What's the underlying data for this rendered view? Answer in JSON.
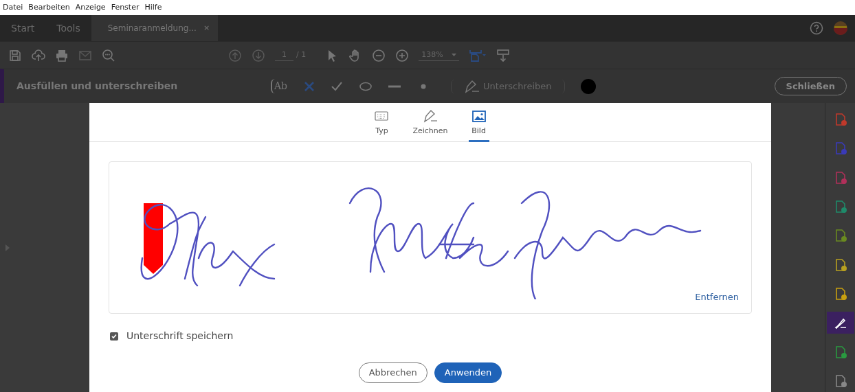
{
  "menu": [
    "Datei",
    "Bearbeiten",
    "Anzeige",
    "Fenster",
    "Hilfe"
  ],
  "tabs": [
    {
      "label": "Start",
      "selected": false
    },
    {
      "label": "Tools",
      "selected": false
    },
    {
      "label": "Seminaranmeldung...",
      "selected": true,
      "close": "×"
    }
  ],
  "toolbar": {
    "page_current": "1",
    "page_total": "/ 1",
    "zoom": "138%"
  },
  "fill_sign": {
    "title": "Ausfüllen und unterschreiben",
    "text_tool": "Ab",
    "sign_label": "Unterschreiben",
    "close_button": "Schließen"
  },
  "side_tools": [
    {
      "color": "#c0392b",
      "selected": false
    },
    {
      "color": "#3a3ab8",
      "selected": false
    },
    {
      "color": "#b0305a",
      "selected": false
    },
    {
      "color": "#1f8a6a",
      "selected": false
    },
    {
      "color": "#6a8a20",
      "selected": false
    },
    {
      "color": "#b8a020",
      "selected": false
    },
    {
      "color": "#c8a010",
      "selected": false
    },
    {
      "color": "#ffffff",
      "selected": true
    },
    {
      "color": "#2a9a40",
      "selected": false
    },
    {
      "color": "#888888",
      "selected": false
    }
  ],
  "dialog": {
    "tabs": [
      {
        "kind": "keyboard",
        "label": "Typ",
        "selected": false
      },
      {
        "kind": "pen",
        "label": "Zeichnen",
        "selected": false
      },
      {
        "kind": "image",
        "label": "Bild",
        "selected": true
      }
    ],
    "remove_link": "Entfernen",
    "save_signature": {
      "label": "Unterschrift speichern",
      "checked": true
    },
    "buttons": [
      {
        "kind": "secondary",
        "label": "Abbrechen"
      },
      {
        "kind": "primary",
        "label": "Anwenden"
      }
    ]
  }
}
